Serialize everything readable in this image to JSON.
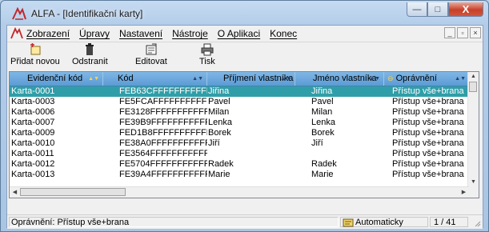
{
  "window": {
    "title": "ALFA - [Identifikační karty]",
    "buttons": {
      "minimize": "—",
      "maximize": "□",
      "close": "X"
    }
  },
  "menu": {
    "items": [
      "Zobrazení",
      "Úpravy",
      "Nastavení",
      "Nástroje",
      "O Aplikaci",
      "Konec"
    ],
    "mdi_buttons": [
      "_",
      "▫",
      "×"
    ]
  },
  "toolbar": {
    "add_label": "Přidat novou",
    "delete_label": "Odstranit",
    "edit_label": "Editovat",
    "print_label": "Tisk"
  },
  "grid": {
    "columns": [
      "Evidenční kód",
      "Kód",
      "Příjmení vlastníka",
      "Jméno vlastníka",
      "Oprávnění"
    ],
    "rows": [
      [
        "Karta-0001",
        "FEB63CFFFFFFFFFFFF",
        "Jiřina",
        "Jiřina",
        "Přístup vše+brana"
      ],
      [
        "Karta-0003",
        "FE5FCAFFFFFFFFFFFF",
        "Pavel",
        "Pavel",
        "Přístup vše+brana"
      ],
      [
        "Karta-0006",
        "FE3128FFFFFFFFFFFF",
        "Milan",
        "Milan",
        "Přístup vše+brana"
      ],
      [
        "Karta-0007",
        "FE39B9FFFFFFFFFFFF",
        "Lenka",
        "Lenka",
        "Přístup vše+brana"
      ],
      [
        "Karta-0009",
        "FED1B8FFFFFFFFFFFF",
        "Borek",
        "Borek",
        "Přístup vše+brana"
      ],
      [
        "Karta-0010",
        "FE38A0FFFFFFFFFFFF",
        "Jiří",
        "Jiří",
        "Přístup vše+brana"
      ],
      [
        "Karta-0011",
        "FE3564FFFFFFFFFFFF",
        "",
        "",
        "Přístup vše+brana"
      ],
      [
        "Karta-0012",
        "FE5704FFFFFFFFFFFF",
        "Radek",
        "Radek",
        "Přístup vše+brana"
      ],
      [
        "Karta-0013",
        "FE39A4FFFFFFFFFFFF",
        "Marie",
        "Marie",
        "Přístup vše+brana"
      ]
    ],
    "selected_row": 0
  },
  "status": {
    "left": "Oprávnění: Přístup vše+brana",
    "mode": "Automaticky",
    "position": "1 / 41"
  },
  "colors": {
    "selection": "#2f9ea8",
    "header": "#6aa6dc",
    "close_button": "#c8402a"
  },
  "icons": {
    "app": "alfa-logo-icon",
    "add": "add-card-icon",
    "delete": "trash-icon",
    "edit": "edit-card-icon",
    "print": "printer-icon",
    "mode": "mode-card-icon"
  }
}
